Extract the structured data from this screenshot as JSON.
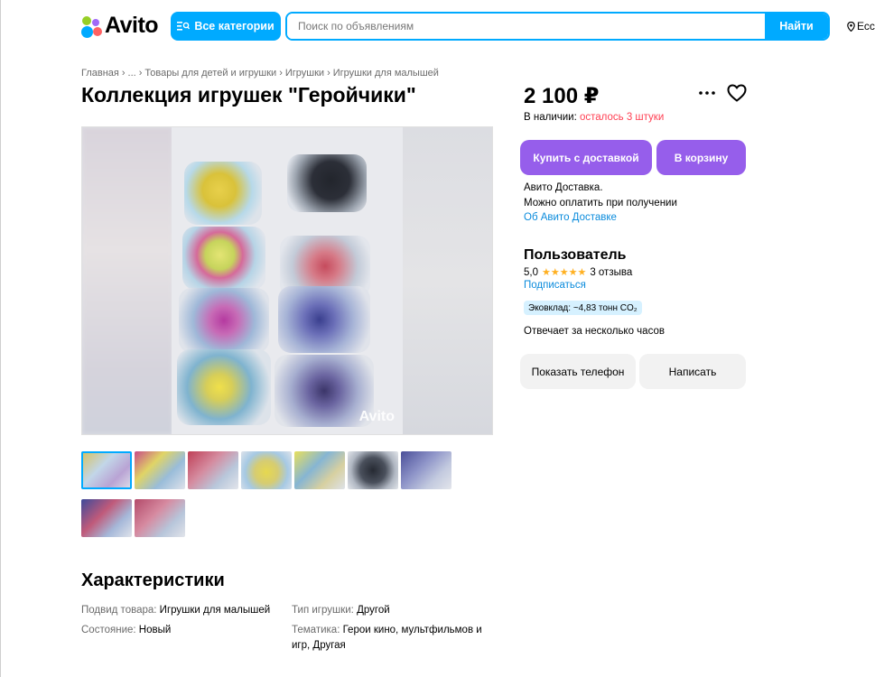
{
  "header": {
    "logo_text": "Avito",
    "categories_label": "Все категории",
    "search_placeholder": "Поиск по объявлениям",
    "search_button": "Найти",
    "location": "Ессентуки"
  },
  "breadcrumbs": [
    "Главная",
    "...",
    "Товары для детей и игрушки",
    "Игрушки",
    "Игрушки для малышей"
  ],
  "listing": {
    "title": "Коллекция игрушек \"Геройчики\"",
    "price": "2 100 ₽",
    "stock_label": "В наличии:",
    "stock_left": "осталось 3 штуки",
    "buy_delivery_button": "Купить с доставкой",
    "cart_button": "В корзину",
    "delivery_line1": "Авито Доставка.",
    "delivery_line2": "Можно оплатить при получении",
    "delivery_link": "Об Авито Доставке",
    "watermark": "Avito"
  },
  "seller": {
    "name": "Пользователь",
    "rating": "5,0",
    "stars": "★★★★★",
    "reviews": "3 отзыва",
    "subscribe": "Подписаться",
    "eco": "Эковклад: ~4,83 тонн CO₂",
    "reply_time": "Отвечает за несколько часов",
    "phone_button": "Показать телефон",
    "write_button": "Написать"
  },
  "characteristics": {
    "title": "Характеристики",
    "items": [
      {
        "key": "Подвид товара:",
        "value": "Игрушки для малышей"
      },
      {
        "key": "Состояние:",
        "value": "Новый"
      },
      {
        "key": "Тип игрушки:",
        "value": "Другой"
      },
      {
        "key": "Тематика:",
        "value": "Герои кино, мультфильмов и игр, Другая"
      }
    ]
  },
  "colors": {
    "brand_blue": "#00aaff",
    "purple": "#965eeb",
    "warn_red": "#ff4053",
    "link_blue": "#0a8bdc"
  },
  "icons": [
    "avito-logo-icon",
    "categories-icon",
    "location-pin-icon",
    "more-icon",
    "heart-icon"
  ]
}
